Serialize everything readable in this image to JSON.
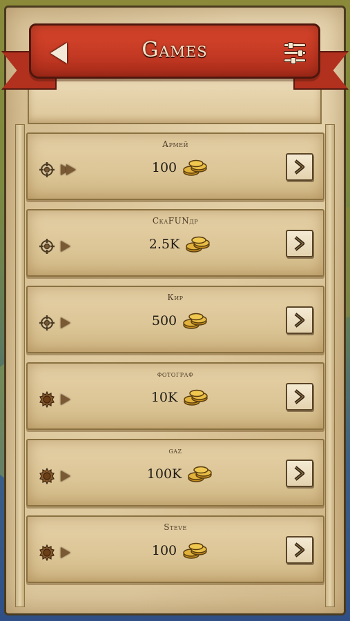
{
  "header": {
    "title": "Games",
    "back_icon": "back-arrow-icon",
    "settings_icon": "sliders-icon"
  },
  "colors": {
    "banner_red": "#c53a24",
    "parchment": "#e4d1a8",
    "coin_gold": "#d9a52a",
    "ink": "#1e1a14"
  },
  "games": [
    {
      "name": "Армей",
      "bet": "100",
      "status_icon": "crosshair-icon",
      "double_arrow": true
    },
    {
      "name": "СкаFUNдр",
      "bet": "2.5K",
      "status_icon": "crosshair-icon",
      "double_arrow": false
    },
    {
      "name": "Кир",
      "bet": "500",
      "status_icon": "crosshair-icon",
      "double_arrow": false
    },
    {
      "name": "фотограф",
      "bet": "10K",
      "status_icon": "gear-mine-icon",
      "double_arrow": false
    },
    {
      "name": "gaz",
      "bet": "100K",
      "status_icon": "gear-mine-icon",
      "double_arrow": false
    },
    {
      "name": "Steve",
      "bet": "100",
      "status_icon": "gear-mine-icon",
      "double_arrow": false
    }
  ]
}
